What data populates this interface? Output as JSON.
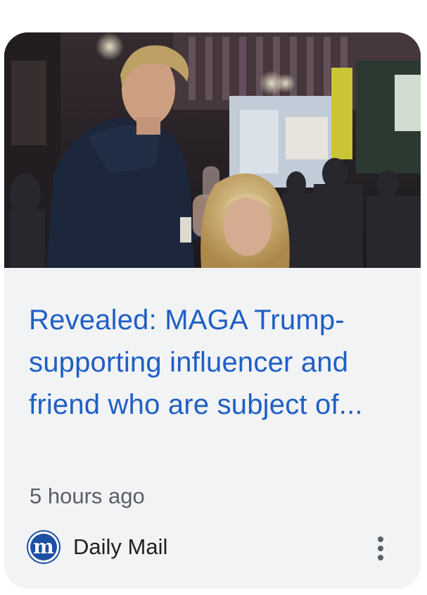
{
  "card": {
    "image_alt": "",
    "headline": "Revealed: MAGA Trump-supporting influencer and friend who are subject of...",
    "time": "5 hours ago",
    "source": {
      "name": "Daily Mail",
      "logo_glyph": "m",
      "logo_color": "#1d4fa3"
    },
    "menu_icon": "more-vert-icon"
  },
  "colors": {
    "headline": "#1f5fc4",
    "card_background": "#f2f3f5",
    "meta_text": "#5b5f66"
  }
}
